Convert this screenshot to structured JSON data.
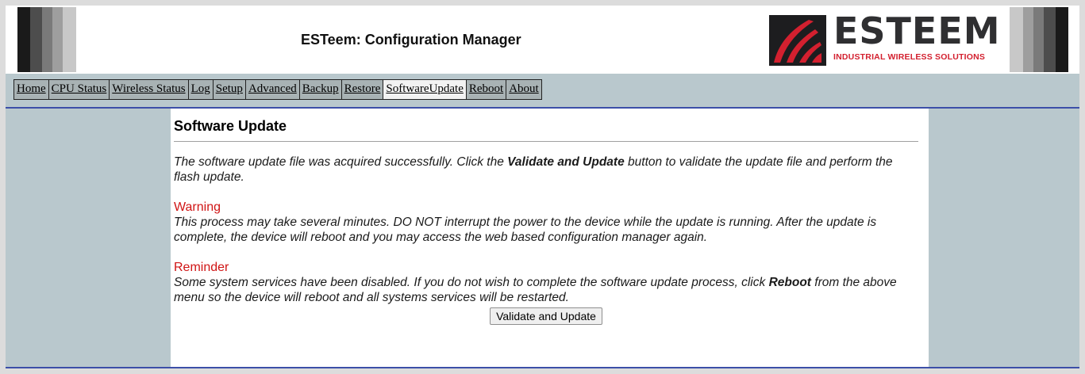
{
  "header": {
    "title": "ESTeem: Configuration Manager",
    "logo_word": "ESTEEM",
    "logo_tagline": "INDUSTRIAL WIRELESS SOLUTIONS"
  },
  "nav": {
    "items": [
      {
        "label": "Home"
      },
      {
        "label": "CPU Status"
      },
      {
        "label": "Wireless Status"
      },
      {
        "label": "Log"
      },
      {
        "label": "Setup"
      },
      {
        "label": "Advanced"
      },
      {
        "label": "Backup"
      },
      {
        "label": "Restore"
      },
      {
        "label": "SoftwareUpdate",
        "active": true
      },
      {
        "label": "Reboot"
      },
      {
        "label": "About"
      }
    ]
  },
  "main": {
    "title": "Software Update",
    "intro_before": "The software update file was acquired successfully. Click the ",
    "intro_bold": "Validate and Update",
    "intro_after": " button to validate the update file and perform the flash update.",
    "warning_label": "Warning",
    "warning_text": "This process may take several minutes. DO NOT interrupt the power to the device while the update is running. After the update is complete, the device will reboot and you may access the web based configuration manager again.",
    "reminder_label": "Reminder",
    "reminder_before": "Some system services have been disabled. If you do not wish to complete the software update process, click ",
    "reminder_bold": "Reboot",
    "reminder_after": " from the above menu so the device will reboot and all systems services will be restarted.",
    "button_label": "Validate and Update"
  },
  "colors": {
    "page_bg": "#b9c8cd",
    "nav_bg": "#a8b2b4",
    "accent_rule": "#3c4fa8",
    "warning_red": "#d01414",
    "brand_red": "#d3202f"
  }
}
